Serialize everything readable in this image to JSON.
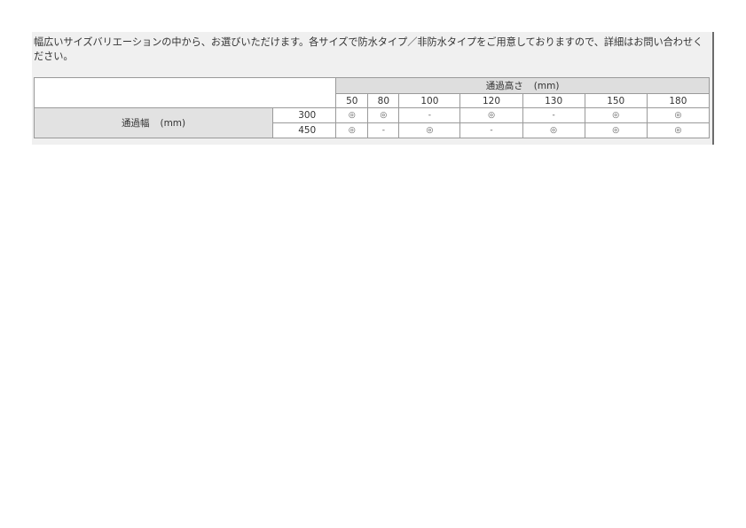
{
  "intro": "幅広いサイズバリエーションの中から、お選びいただけます。各サイズで防水タイプ／非防水タイプをご用意しておりますので、詳細はお問い合わせください。",
  "table": {
    "height_header": "通過高さ",
    "height_unit": "(mm)",
    "heights": [
      "50",
      "80",
      "100",
      "120",
      "130",
      "150",
      "180"
    ],
    "width_header": "通過幅",
    "width_unit": "(mm)",
    "rows": [
      {
        "width": "300",
        "cells": [
          "◎",
          "◎",
          "-",
          "◎",
          "-",
          "◎",
          "◎"
        ]
      },
      {
        "width": "450",
        "cells": [
          "◎",
          "-",
          "◎",
          "-",
          "◎",
          "◎",
          "◎"
        ]
      }
    ]
  }
}
